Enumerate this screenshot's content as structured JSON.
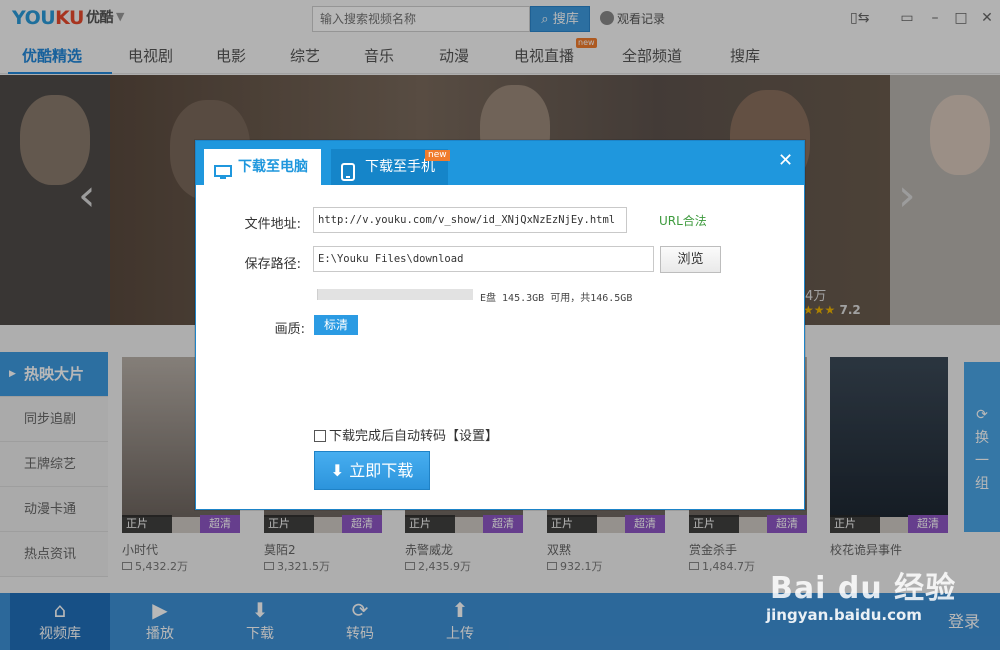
{
  "app": {
    "logo_latin": "YOUKU",
    "logo_cn": "优酷",
    "search_placeholder": "输入搜索视频名称",
    "search_button": "搜库",
    "history_label": "观看记录"
  },
  "nav": {
    "items": [
      "优酷精选",
      "电视剧",
      "电影",
      "综艺",
      "音乐",
      "动漫",
      "电视直播",
      "全部频道",
      "搜库"
    ],
    "new_badge": "new"
  },
  "banner": {
    "views": "4万",
    "rating": "7.2"
  },
  "sidebar": {
    "items": [
      "热映大片",
      "同步追剧",
      "王牌综艺",
      "动漫卡通",
      "热点资讯"
    ]
  },
  "posters": [
    {
      "tag": "正片",
      "quality": "超清",
      "title": "小时代",
      "views": "5,432.2万"
    },
    {
      "tag": "正片",
      "quality": "超清",
      "title": "莫陌2",
      "views": "3,321.5万"
    },
    {
      "tag": "正片",
      "quality": "超清",
      "title": "赤警威龙",
      "views": "2,435.9万"
    },
    {
      "tag": "正片",
      "quality": "超清",
      "title": "双黙",
      "views": "932.1万"
    },
    {
      "tag": "正片",
      "quality": "超清",
      "title": "赏金杀手",
      "views": "1,484.7万"
    },
    {
      "tag": "正片",
      "quality": "超清",
      "title": "校花诡异事件",
      "views": ""
    }
  ],
  "swap_label": [
    "换",
    "一",
    "组"
  ],
  "bottom_bar": {
    "items": [
      "视频库",
      "播放",
      "下载",
      "转码",
      "上传"
    ],
    "login": "登录"
  },
  "dialog": {
    "tab_pc": "下载至电脑",
    "tab_phone": "下载至手机",
    "tab_new_badge": "new",
    "url_label": "文件地址:",
    "url_value": "http://v.youku.com/v_show/id_XNjQxNzEzNjEy.html",
    "url_link": "URL合法",
    "path_label": "保存路径:",
    "path_value": "E:\\Youku Files\\download",
    "browse_button": "浏览",
    "disk_info": "E盘 145.3GB 可用，共146.5GB",
    "disk_free_fraction": 0.992,
    "quality_label": "画质:",
    "quality_value": "标清",
    "auto_transcode_label": "下载完成后自动转码【设置】",
    "auto_transcode_checked": false,
    "download_button": "立即下载"
  },
  "watermark": {
    "logo": "Bai du 经验",
    "url": "jingyan.baidu.com"
  },
  "colors": {
    "brand_blue": "#1f97dd",
    "accent_orange": "#f07c2d",
    "quality_purple": "#8e57c4"
  }
}
